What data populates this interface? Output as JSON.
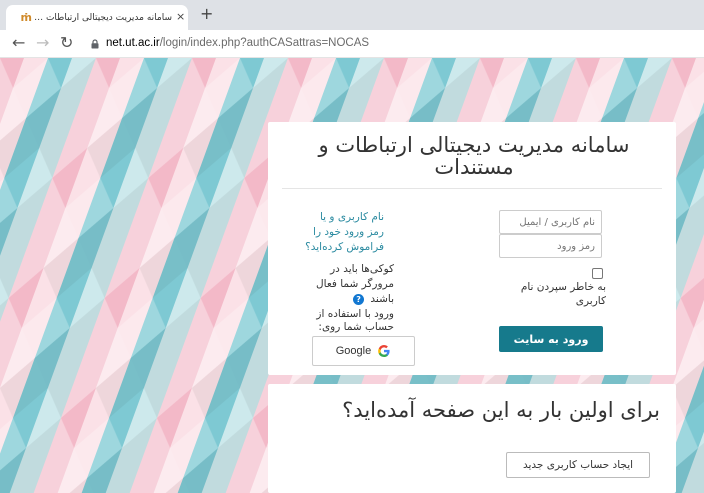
{
  "browser": {
    "tab_title": "سامانه مدیریت دیجیتالی ارتباطات و مستندات",
    "tab_close": "×",
    "new_tab": "+",
    "url_host": "net.ut.ac.ir",
    "url_path": "/login/index.php?authCASattras=NOCAS"
  },
  "login": {
    "title": "سامانه مدیریت دیجیتالی ارتباطات و مستندات",
    "username_placeholder": "نام کاربری / ایمیل",
    "password_placeholder": "رمز ورود",
    "forgot_link": "نام کاربری و یا رمز ورود خود را فراموش کرده‌اید؟",
    "cookies_notice": "کوکی‌ها باید در مرورگر شما فعال باشند",
    "remember_label": "به خاطر سپردن نام کاربری",
    "login_button": "ورود به سایت",
    "oauth_label": "ورود با استفاده از حساب شما روی:",
    "google_label": "Google"
  },
  "first_time": {
    "title": "برای اولین بار به این صفحه آمده‌اید؟",
    "signup_button": "ایجاد حساب کاربری جدید"
  },
  "colors": {
    "accent": "#167a8c",
    "link": "#2a8aa0",
    "pink": "#f0b3c4",
    "teal": "#7fcbd4",
    "cream": "#efeee0"
  }
}
